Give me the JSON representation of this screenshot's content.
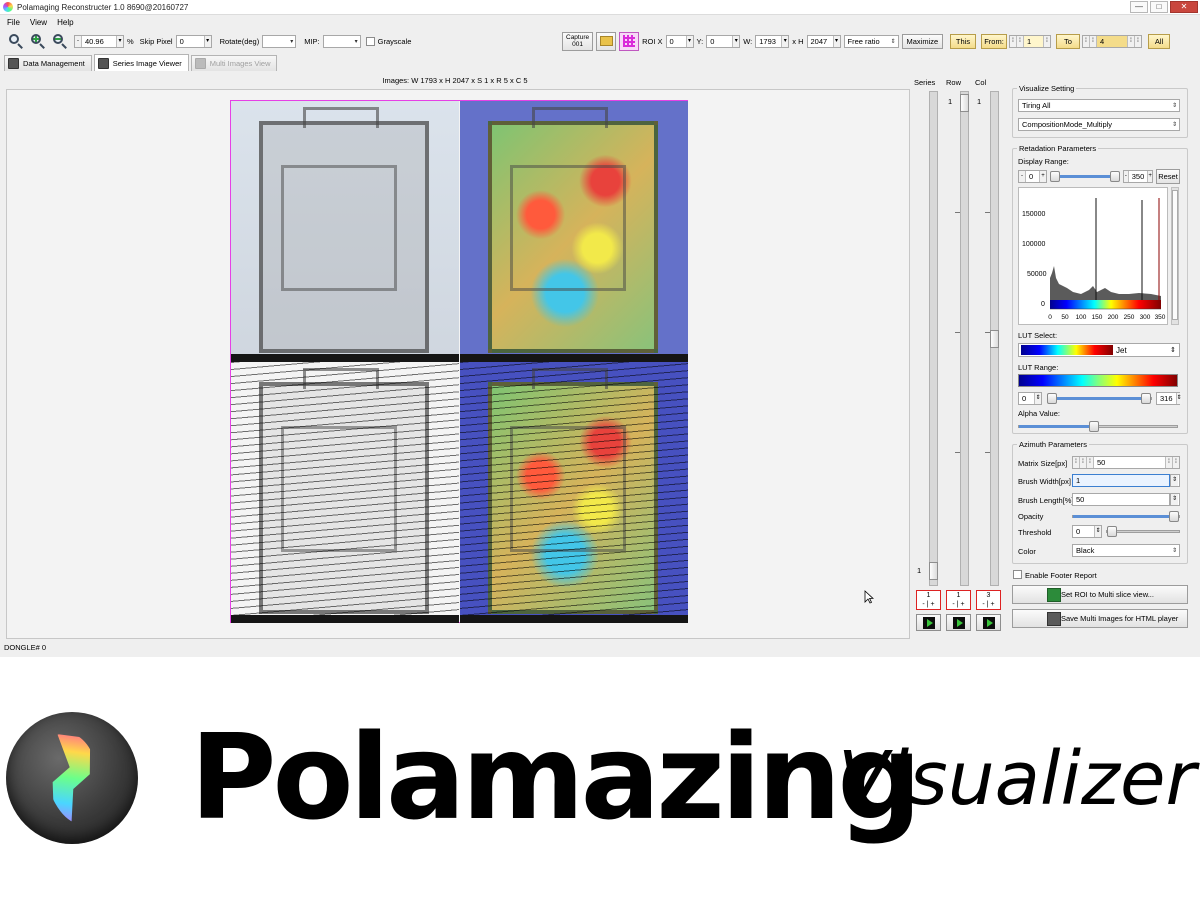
{
  "window": {
    "title": "Polamaging Reconstructer 1.0 8690@20160727",
    "controls": {
      "minimize": "—",
      "maximize": "□",
      "close": "✕"
    }
  },
  "menu": [
    "File",
    "View",
    "Help"
  ],
  "toolbar": {
    "zoom_value": "40.96",
    "zoom_unit": "%",
    "skip_pixel_label": "Skip Pixel",
    "skip_pixel_value": "0",
    "rotate_label": "Rotate(deg)",
    "rotate_value": "",
    "mip_label": "MIP:",
    "mip_value": "",
    "grayscale_label": "Grayscale",
    "capture_label": "Capture",
    "capture_index": "001",
    "roi_x_label": "ROI X",
    "roi_x": "0",
    "roi_y_label": "Y:",
    "roi_y": "0",
    "roi_w_label": "W:",
    "roi_w": "1793",
    "roi_h_label": "x H",
    "roi_h": "2047",
    "ratio_value": "Free ratio",
    "maximize_label": "Maximize",
    "this_label": "This",
    "from_label": "From:",
    "from_value": "1",
    "to_label": "To",
    "to_value": "4",
    "all_label": "All"
  },
  "tabs": [
    {
      "label": "Data Management",
      "state": "normal"
    },
    {
      "label": "Series Image Viewer",
      "state": "active"
    },
    {
      "label": "Multi Images View",
      "state": "disabled"
    }
  ],
  "viewer": {
    "caption": "Images: W 1793 x H 2047 x S 1 x R 5 x C 5"
  },
  "slicers": {
    "series": {
      "label": "Series",
      "top_value": "",
      "bottom_value": "1",
      "current": "1"
    },
    "row": {
      "label": "Row",
      "top_value": "1",
      "current": "1"
    },
    "col": {
      "label": "Col",
      "top_value": "1",
      "current": "3"
    }
  },
  "panel": {
    "visualize_title": "Visualize Setting",
    "tiling_value": "Tiring All",
    "composition_value": "CompositionMode_Multiply",
    "retardation_title": "Retadation Parameters",
    "display_range_label": "Display Range:",
    "display_min": "0",
    "display_max": "350",
    "reset_label": "Reset",
    "histogram": {
      "y_ticks": [
        "150000",
        "100000",
        "50000",
        "0"
      ],
      "x_ticks": [
        "0",
        "50",
        "100",
        "150",
        "200",
        "250",
        "300",
        "350"
      ]
    },
    "lut_select_label": "LUT Select:",
    "lut_value": "Jet",
    "lut_range_label": "LUT Range:",
    "lut_min": "0",
    "lut_max": "316",
    "alpha_label": "Alpha Value:",
    "azimuth_title": "Azimuth Parameters",
    "matrix_size_label": "Matrix Size[px]",
    "matrix_size_value": "50",
    "brush_width_label": "Brush Width[px]",
    "brush_width_value": "1",
    "brush_length_label": "Brush Length[%]",
    "brush_length_value": "50",
    "opacity_label": "Opacity",
    "threshold_label": "Threshold",
    "threshold_value": "0",
    "color_label": "Color",
    "color_value": "Black",
    "footer_report_label": "Enable Footer Report",
    "set_roi_label": "Set ROI to Multi slice view...",
    "save_multi_label": "Save Multi Images for HTML player"
  },
  "status": {
    "text": "DONGLE# 0"
  },
  "brand": {
    "name": "Polamazing",
    "sub": "Visualizer"
  },
  "colors": {
    "accent_magenta": "#e640e6",
    "red_box": "#dd2222",
    "toolbar_yellow": "#f4dc8a"
  },
  "icons": [
    "app-icon",
    "zoom-fit-icon",
    "zoom-in-icon",
    "zoom-out-icon",
    "folder-icon",
    "grid-roi-icon",
    "play-icon",
    "save-icon",
    "roi-icon"
  ]
}
